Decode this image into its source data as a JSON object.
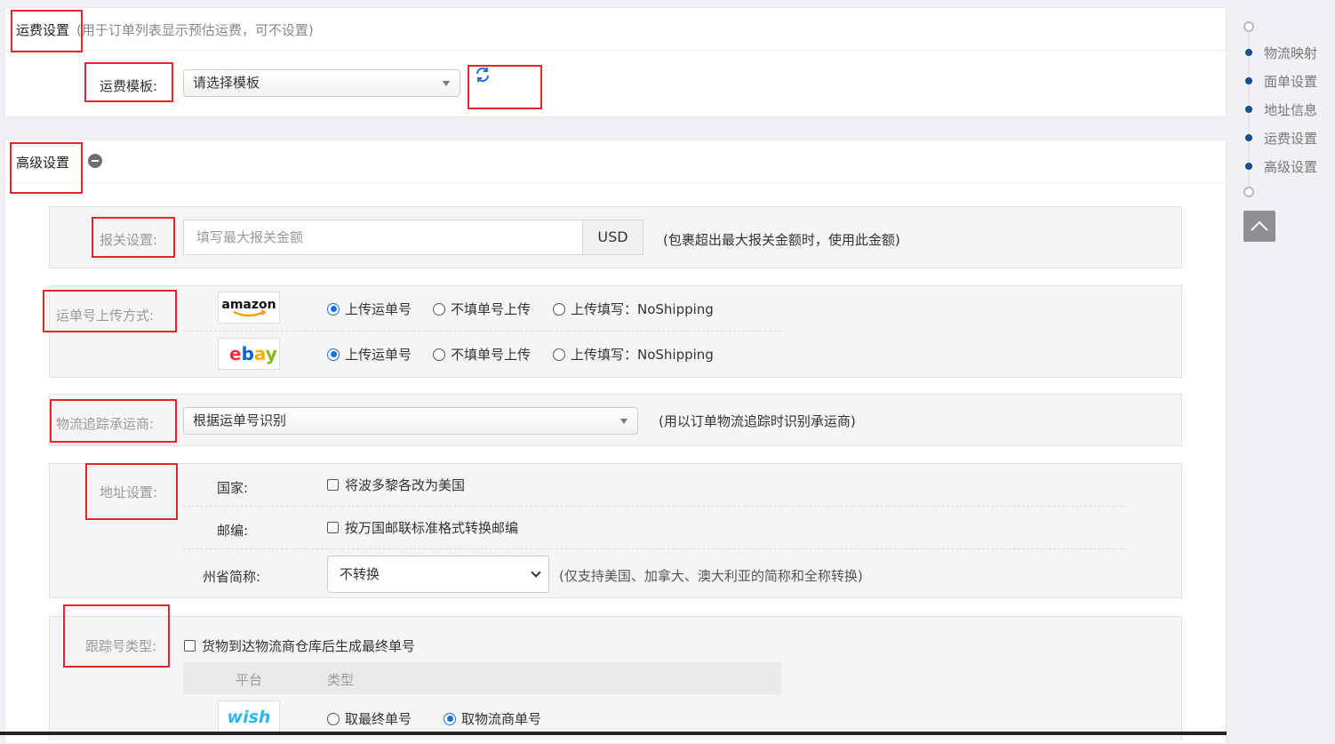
{
  "freight": {
    "title": "运费设置",
    "hint": "(用于订单列表显示预估运费，可不设置)",
    "template_label": "运费模板:",
    "template_value": "请选择模板",
    "refresh_icon": "refresh-icon"
  },
  "advanced": {
    "title": "高级设置",
    "collapse_icon": "minus-circle-icon",
    "customs": {
      "label": "报关设置:",
      "placeholder": "填写最大报关金额",
      "currency": "USD",
      "hint": "(包裹超出最大报关金额时，使用此金额)"
    },
    "upload": {
      "label": "运单号上传方式:",
      "rows": [
        {
          "platform": "amazon",
          "options": [
            "上传运单号",
            "不填单号上传",
            "上传填写：NoShipping"
          ],
          "selected": 0
        },
        {
          "platform": "ebay",
          "options": [
            "上传运单号",
            "不填单号上传",
            "上传填写：NoShipping"
          ],
          "selected": 0
        }
      ]
    },
    "carrier": {
      "label": "物流追踪承运商:",
      "value": "根据运单号识别",
      "hint": "(用以订单物流追踪时识别承运商)"
    },
    "address": {
      "label": "地址设置:",
      "country_label": "国家:",
      "country_check": "将波多黎各改为美国",
      "zip_label": "邮编:",
      "zip_check": "按万国邮联标准格式转换邮编",
      "state_label": "州省简称:",
      "state_value": "不转换",
      "state_hint": "(仅支持美国、加拿大、澳大利亚的简称和全称转换)"
    },
    "tracking": {
      "label": "跟踪号类型:",
      "check": "货物到达物流商仓库后生成最终单号",
      "col_platform": "平台",
      "col_type": "类型",
      "row_platform": "wish",
      "options": [
        "取最终单号",
        "取物流商单号"
      ],
      "selected": 1
    }
  },
  "sidenav": {
    "items": [
      "物流映射",
      "面单设置",
      "地址信息",
      "运费设置",
      "高级设置"
    ],
    "top_icon": "chevron-up-icon"
  },
  "colors": {
    "accent": "#1a6fd6",
    "highlight": "#e4252d",
    "nav_dot": "#1a4f8f"
  }
}
